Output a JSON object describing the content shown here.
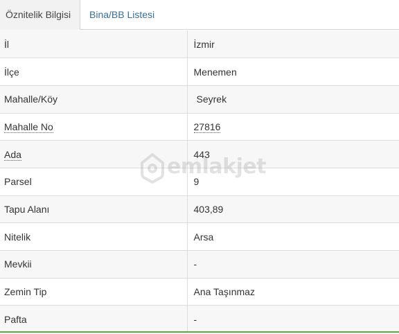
{
  "tabs": [
    {
      "label": "Öznitelik Bilgisi",
      "active": true
    },
    {
      "label": "Bina/BB Listesi",
      "active": false
    }
  ],
  "rows": [
    {
      "label": "İl",
      "value": "İzmir"
    },
    {
      "label": "İlçe",
      "value": "Menemen"
    },
    {
      "label": "Mahalle/Köy",
      "value": "Seyrek"
    },
    {
      "label": "Mahalle No",
      "value": "27816"
    },
    {
      "label": "Ada",
      "value": "443"
    },
    {
      "label": "Parsel",
      "value": "9"
    },
    {
      "label": "Tapu Alanı",
      "value": "403,89"
    },
    {
      "label": "Nitelik",
      "value": "Arsa"
    },
    {
      "label": "Mevkii",
      "value": "-"
    },
    {
      "label": "Zemin Tip",
      "value": "Ana Taşınmaz"
    },
    {
      "label": "Pafta",
      "value": "-"
    }
  ],
  "watermark": {
    "text": "emlakjet",
    "icon": "house-pin-icon"
  },
  "colors": {
    "tab_link": "#3a6e96",
    "row_stripe": "#f7f7f7",
    "accent_line": "#6aa84f"
  }
}
